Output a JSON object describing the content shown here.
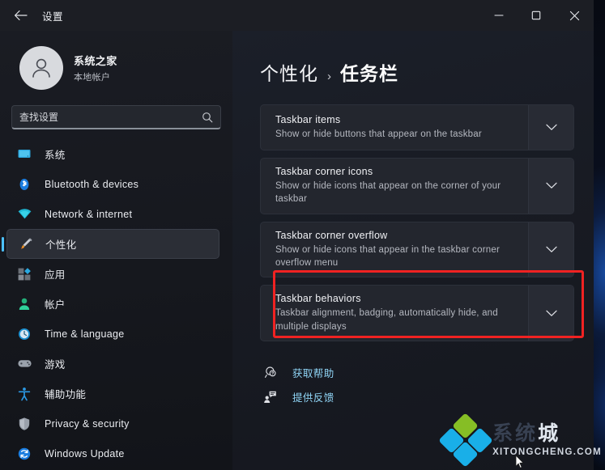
{
  "window": {
    "title": "设置",
    "back_label": "back-arrow",
    "controls": {
      "minimize": "—",
      "maximize": "□",
      "close": "✕"
    }
  },
  "sidebar": {
    "profile": {
      "name": "系统之家",
      "account_type": "本地帐户"
    },
    "search": {
      "placeholder": "查找设置",
      "value": "",
      "icon": "search-icon"
    },
    "items": [
      {
        "label": "系统",
        "icon": "system-monitor-icon",
        "selected": false
      },
      {
        "label": "Bluetooth & devices",
        "icon": "bluetooth-icon",
        "selected": false
      },
      {
        "label": "Network & internet",
        "icon": "wifi-icon",
        "selected": false
      },
      {
        "label": "个性化",
        "icon": "paintbrush-icon",
        "selected": true
      },
      {
        "label": "应用",
        "icon": "apps-icon",
        "selected": false
      },
      {
        "label": "帐户",
        "icon": "account-person-icon",
        "selected": false
      },
      {
        "label": "Time & language",
        "icon": "clock-icon",
        "selected": false
      },
      {
        "label": "游戏",
        "icon": "gamepad-icon",
        "selected": false
      },
      {
        "label": "辅助功能",
        "icon": "accessibility-icon",
        "selected": false
      },
      {
        "label": "Privacy & security",
        "icon": "shield-icon",
        "selected": false
      },
      {
        "label": "Windows Update",
        "icon": "update-refresh-icon",
        "selected": false
      }
    ]
  },
  "main": {
    "breadcrumb": {
      "parent": "个性化",
      "separator": "›",
      "current": "任务栏"
    },
    "cards": [
      {
        "title": "Taskbar items",
        "subtitle": "Show or hide buttons that appear on the taskbar",
        "expander": "chevron-down-icon",
        "highlighted": false
      },
      {
        "title": "Taskbar corner icons",
        "subtitle": "Show or hide icons that appear on the corner of your taskbar",
        "expander": "chevron-down-icon",
        "highlighted": false
      },
      {
        "title": "Taskbar corner overflow",
        "subtitle": "Show or hide icons that appear in the taskbar corner overflow menu",
        "expander": "chevron-down-icon",
        "highlighted": false
      },
      {
        "title": "Taskbar behaviors",
        "subtitle": "Taskbar alignment, badging, automatically hide, and multiple displays",
        "expander": "chevron-down-icon",
        "highlighted": true
      }
    ],
    "links": [
      {
        "label": "获取帮助",
        "icon": "help-question-icon"
      },
      {
        "label": "提供反馈",
        "icon": "feedback-icon"
      }
    ]
  },
  "watermark": {
    "brand_cn_part1": "系统",
    "brand_cn_part2": "城",
    "brand_en": "XITONGCHENG.COM"
  },
  "colors": {
    "accent": "#4cc2ff",
    "link": "#8fd4f5",
    "highlight_box": "#f02222",
    "window_bg": "#14161c",
    "sidebar_bg": "#191b21",
    "card_bg": "#23262e"
  }
}
